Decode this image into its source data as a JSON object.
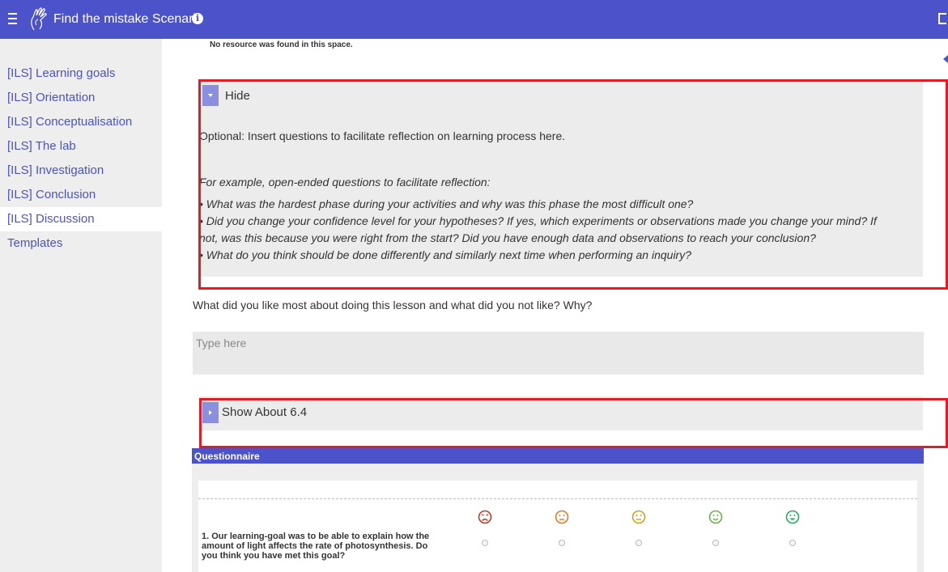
{
  "app": {
    "title": "Find the mistake Scenario",
    "icons": [
      "menu-icon",
      "hand-logo-icon",
      "info-icon",
      "exit-icon"
    ],
    "accent_color": "#4c52c9"
  },
  "sidebar": {
    "items": [
      {
        "label": "[ILS] Learning goals"
      },
      {
        "label": "[ILS] Orientation"
      },
      {
        "label": "[ILS] Conceptualisation"
      },
      {
        "label": "[ILS] The lab"
      },
      {
        "label": "[ILS] Investigation"
      },
      {
        "label": "[ILS] Conclusion"
      },
      {
        "label": "[ILS] Discussion",
        "active": true
      },
      {
        "label": "Templates"
      }
    ]
  },
  "main": {
    "no_resource": "No resource was found in this space.",
    "hint": {
      "toggle_label": "Hide",
      "lines": [
        "Optional: Insert questions to facilitate reflection on learning process here.",
        "For example, open-ended questions to facilitate reflection:",
        "• What was the hardest phase during your activities and why was this phase the most difficult one?",
        "• Did you change your confidence level for your hypotheses? If yes, which experiments or observations made you change your mind? If",
        "not, was this because you were right from the start? Did you have enough data and observations to reach your conclusion?",
        "• What do you think should be done differently and similarly next time when performing an inquiry?"
      ]
    },
    "question": "What did you like most about doing this lesson and what did you not like? Why?",
    "answer_placeholder": "Type here",
    "about": {
      "toggle_label": "Show About 6.4"
    },
    "questionnaire": {
      "header": "Questionnaire",
      "faces": [
        {
          "icon": "very-sad-face-icon",
          "color": "#c0392b"
        },
        {
          "icon": "sad-face-icon",
          "color": "#e07b2a"
        },
        {
          "icon": "neutral-face-icon",
          "color": "#d4a017"
        },
        {
          "icon": "smile-face-icon",
          "color": "#6ab04c"
        },
        {
          "icon": "happy-face-icon",
          "color": "#27ae60"
        }
      ],
      "question_1": "1. Our learning-goal was to be able to explain how the amount of light affects the rate of photosynthesis. Do you think you have met this goal?"
    }
  }
}
